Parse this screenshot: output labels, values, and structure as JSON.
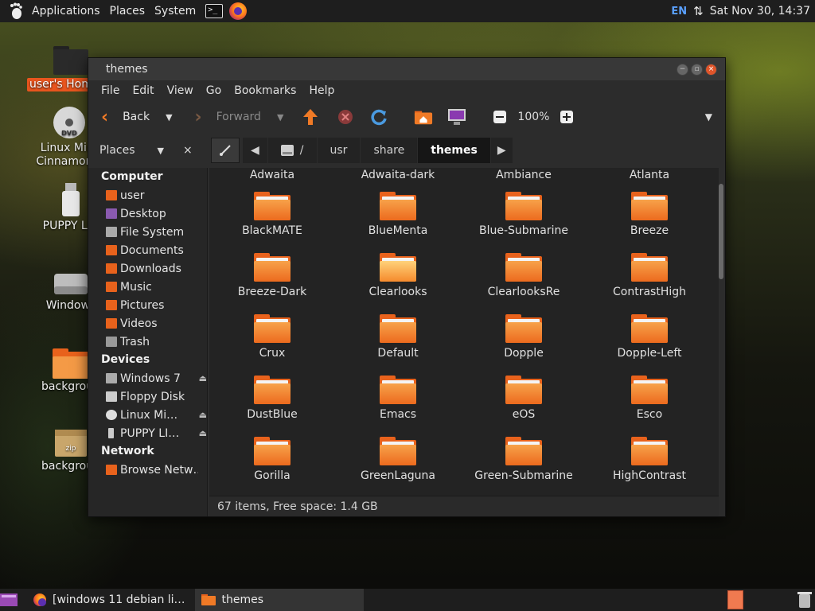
{
  "top_panel": {
    "menus": [
      "Applications",
      "Places",
      "System"
    ],
    "lang": "EN",
    "clock": "Sat Nov 30, 14:37"
  },
  "desktop": {
    "icons": [
      {
        "label": "user's Home",
        "icon": "home-folder-icon",
        "selected": true
      },
      {
        "label": "Linux Mint Cinnamon c",
        "icon": "dvd-icon"
      },
      {
        "label": "PUPPY LIN",
        "icon": "usb-drive-icon"
      },
      {
        "label": "Windows",
        "icon": "hard-disk-icon"
      },
      {
        "label": "backgroun",
        "icon": "folder-icon"
      },
      {
        "label": "backgroun",
        "icon": "zip-archive-icon"
      }
    ]
  },
  "window": {
    "title": "themes",
    "menu": [
      "File",
      "Edit",
      "View",
      "Go",
      "Bookmarks",
      "Help"
    ],
    "toolbar": {
      "back": "Back",
      "forward": "Forward",
      "zoom": "100%"
    },
    "sidebar_title": "Places",
    "path": [
      "usr",
      "share",
      "themes"
    ],
    "path_root": "/",
    "sidebar": {
      "sections": [
        {
          "title": "Computer",
          "items": [
            {
              "label": "user",
              "icon": "home-icon",
              "color": "#e8621c"
            },
            {
              "label": "Desktop",
              "icon": "desktop-icon",
              "color": "#8a5ab0"
            },
            {
              "label": "File System",
              "icon": "drive-icon",
              "color": "#aaaaaa"
            },
            {
              "label": "Documents",
              "icon": "documents-icon",
              "color": "#e8621c"
            },
            {
              "label": "Downloads",
              "icon": "downloads-icon",
              "color": "#e8621c"
            },
            {
              "label": "Music",
              "icon": "music-icon",
              "color": "#e8621c"
            },
            {
              "label": "Pictures",
              "icon": "pictures-icon",
              "color": "#e8621c"
            },
            {
              "label": "Videos",
              "icon": "videos-icon",
              "color": "#e8621c"
            },
            {
              "label": "Trash",
              "icon": "trash-icon",
              "color": "#999999"
            }
          ]
        },
        {
          "title": "Devices",
          "items": [
            {
              "label": "Windows 7",
              "icon": "drive-icon",
              "color": "#aaaaaa",
              "eject": true
            },
            {
              "label": "Floppy Disk",
              "icon": "floppy-icon",
              "color": "#cccccc"
            },
            {
              "label": "Linux Mi…",
              "icon": "disc-icon",
              "color": "#dddddd",
              "eject": true
            },
            {
              "label": "PUPPY LI…",
              "icon": "usb-icon",
              "color": "#cccccc",
              "eject": true
            }
          ]
        },
        {
          "title": "Network",
          "items": [
            {
              "label": "Browse Netw…",
              "icon": "network-icon",
              "color": "#e8621c"
            }
          ]
        }
      ]
    },
    "header_row": [
      "Adwaita",
      "Adwaita-dark",
      "Ambiance",
      "Atlanta"
    ],
    "folders": [
      [
        "BlackMATE",
        "BlueMenta",
        "Blue-Submarine",
        "Breeze"
      ],
      [
        "Breeze-Dark",
        "Clearlooks",
        "ClearlooksRe",
        "ContrastHigh"
      ],
      [
        "Crux",
        "Default",
        "Dopple",
        "Dopple-Left"
      ],
      [
        "DustBlue",
        "Emacs",
        "eOS",
        "Esco"
      ],
      [
        "Gorilla",
        "GreenLaguna",
        "Green-Submarine",
        "HighContrast"
      ]
    ],
    "status": "67 items, Free space: 1.4 GB"
  },
  "bottom_panel": {
    "tasks": [
      "[windows 11 debian li…",
      "themes"
    ]
  },
  "colors": {
    "accent": "#e8621c",
    "panel": "#1e1e1e"
  }
}
